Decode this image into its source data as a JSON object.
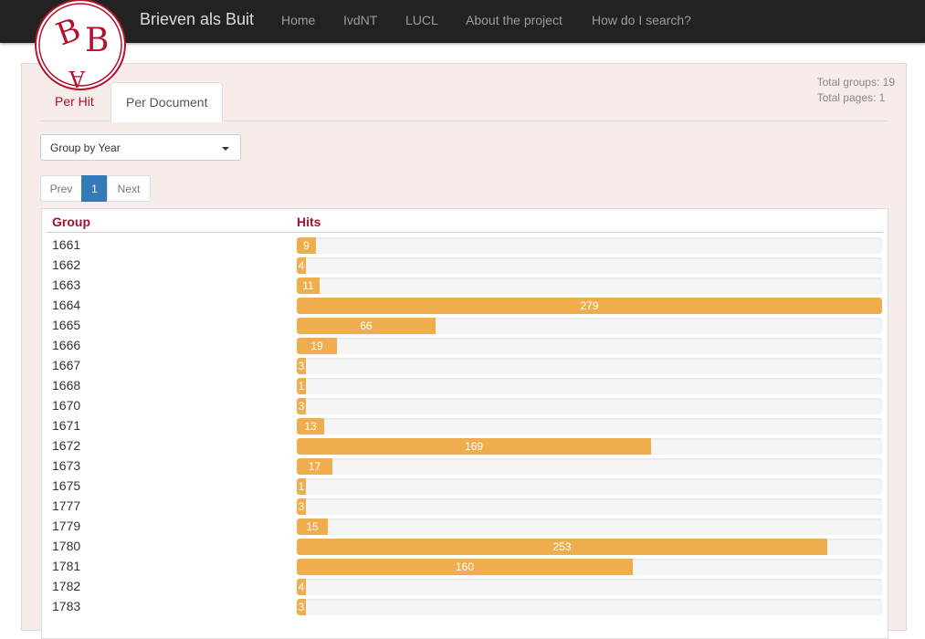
{
  "brand": "Brieven als Buit",
  "nav": [
    "Home",
    "IvdNT",
    "LUCL",
    "About the project",
    "How do I search?"
  ],
  "totals": {
    "groups": "Total groups: 19",
    "pages": "Total pages: 1"
  },
  "tabs": {
    "per_hit": "Per Hit",
    "per_document": "Per Document"
  },
  "group_select": {
    "value": "Group by Year"
  },
  "pagination": {
    "prev": "Prev",
    "current": "1",
    "next": "Next"
  },
  "table": {
    "col_group": "Group",
    "col_hits": "Hits",
    "max_hits": 279,
    "rows": [
      {
        "group": "1661",
        "hits": 9
      },
      {
        "group": "1662",
        "hits": 4
      },
      {
        "group": "1663",
        "hits": 11
      },
      {
        "group": "1664",
        "hits": 279
      },
      {
        "group": "1665",
        "hits": 66
      },
      {
        "group": "1666",
        "hits": 19
      },
      {
        "group": "1667",
        "hits": 3
      },
      {
        "group": "1668",
        "hits": 1
      },
      {
        "group": "1670",
        "hits": 3
      },
      {
        "group": "1671",
        "hits": 13
      },
      {
        "group": "1672",
        "hits": 169
      },
      {
        "group": "1673",
        "hits": 17
      },
      {
        "group": "1675",
        "hits": 1
      },
      {
        "group": "1777",
        "hits": 3
      },
      {
        "group": "1779",
        "hits": 15
      },
      {
        "group": "1780",
        "hits": 253
      },
      {
        "group": "1781",
        "hits": 160
      },
      {
        "group": "1782",
        "hits": 4
      },
      {
        "group": "1783",
        "hits": 3
      }
    ]
  },
  "colors": {
    "accent": "#a8102f",
    "bar": "#f0ad4e",
    "navbar": "#222222",
    "panel": "#f6ece9",
    "page_active": "#337ab7"
  },
  "icons": {
    "logo": "brieven-als-buit-logo",
    "dropdown": "caret-down-icon"
  }
}
